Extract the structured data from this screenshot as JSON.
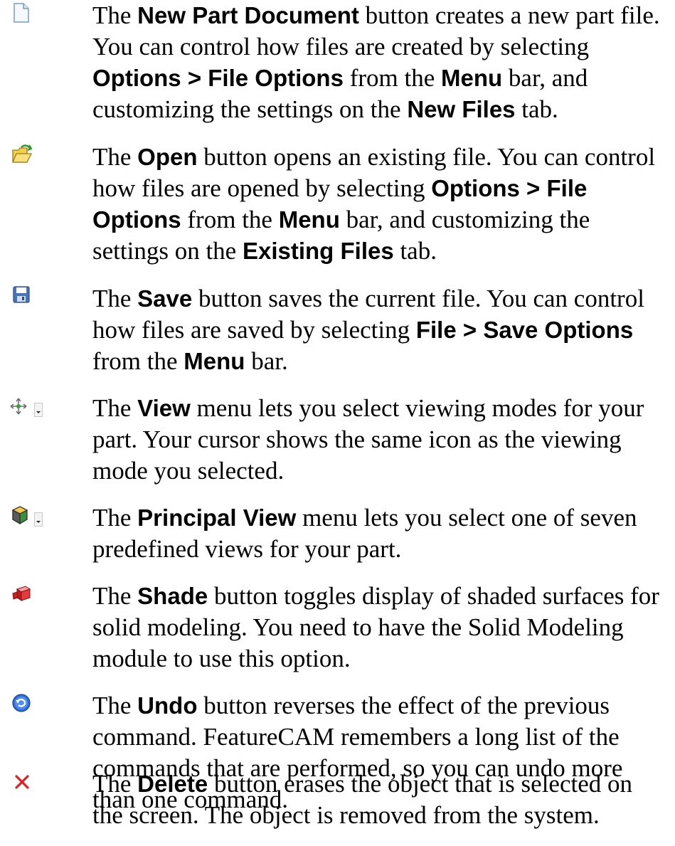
{
  "entries": [
    {
      "icon": "new-document-icon",
      "parts": [
        {
          "t": "The ",
          "b": false
        },
        {
          "t": "New Part Document",
          "b": true
        },
        {
          "t": " button creates a new part file. You can control how files are created by selecting ",
          "b": false
        },
        {
          "t": "Options > File Options",
          "b": true
        },
        {
          "t": " from the ",
          "b": false
        },
        {
          "t": "Menu",
          "b": true
        },
        {
          "t": " bar, and customizing the settings on the ",
          "b": false
        },
        {
          "t": "New Files",
          "b": true
        },
        {
          "t": " tab.",
          "b": false
        }
      ]
    },
    {
      "icon": "open-folder-icon",
      "parts": [
        {
          "t": "The ",
          "b": false
        },
        {
          "t": "Open",
          "b": true
        },
        {
          "t": " button opens an existing file. You can control how files are opened by selecting ",
          "b": false
        },
        {
          "t": "Options > File Options",
          "b": true
        },
        {
          "t": " from the ",
          "b": false
        },
        {
          "t": "Menu",
          "b": true
        },
        {
          "t": " bar, and customizing the settings on the ",
          "b": false
        },
        {
          "t": "Existing Files",
          "b": true
        },
        {
          "t": " tab.",
          "b": false
        }
      ]
    },
    {
      "icon": "save-disk-icon",
      "parts": [
        {
          "t": "The ",
          "b": false
        },
        {
          "t": "Save",
          "b": true
        },
        {
          "t": " button saves the current file. You can control how files are saved by selecting ",
          "b": false
        },
        {
          "t": "File > Save Options",
          "b": true
        },
        {
          "t": " from the ",
          "b": false
        },
        {
          "t": "Menu",
          "b": true
        },
        {
          "t": " bar.",
          "b": false
        }
      ]
    },
    {
      "icon": "view-mode-icon",
      "parts": [
        {
          "t": "The ",
          "b": false
        },
        {
          "t": "View",
          "b": true
        },
        {
          "t": " menu lets you select viewing modes for your part. Your cursor shows the same icon as the viewing mode you selected.",
          "b": false
        }
      ]
    },
    {
      "icon": "principal-view-icon",
      "parts": [
        {
          "t": "The ",
          "b": false
        },
        {
          "t": "Principal View",
          "b": true
        },
        {
          "t": " menu lets you select one of seven predefined views for your part.",
          "b": false
        }
      ]
    },
    {
      "icon": "shade-icon",
      "parts": [
        {
          "t": "The ",
          "b": false
        },
        {
          "t": "Shade",
          "b": true
        },
        {
          "t": " button toggles display of shaded surfaces for solid modeling. You need to have the Solid Modeling module to use this option.",
          "b": false
        }
      ]
    },
    {
      "icon": "undo-icon",
      "parts": [
        {
          "t": "The ",
          "b": false
        },
        {
          "t": "Undo",
          "b": true
        },
        {
          "t": " button reverses the effect of the previous command. FeatureCAM remembers a long list of the commands that are performed, so you can undo more than one command.",
          "b": false
        }
      ]
    },
    {
      "icon": "delete-x-icon",
      "parts": [
        {
          "t": "The ",
          "b": false
        },
        {
          "t": "Delete",
          "b": true
        },
        {
          "t": " button erases the object that is selected on the screen. The object is removed from the system.",
          "b": false
        }
      ]
    }
  ]
}
